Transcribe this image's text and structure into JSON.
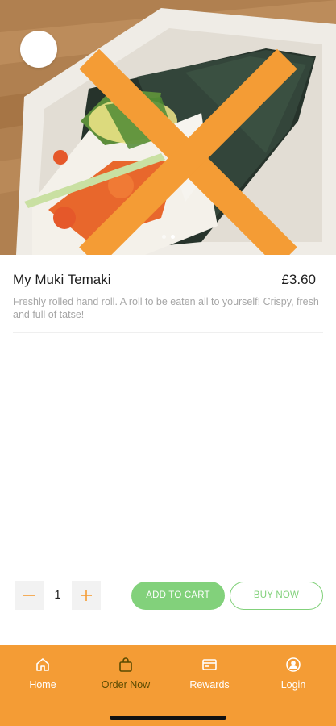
{
  "product": {
    "title": "My Muki Temaki",
    "price": "£3.60",
    "description": "Freshly rolled hand roll. A roll to be eaten all to yourself! Crispy, fresh and full of tatse!",
    "image_icon": "temaki-photo",
    "carousel": {
      "count": 2,
      "active_index": 1
    }
  },
  "quantity": {
    "value": "1",
    "minus_icon": "minus-icon",
    "plus_icon": "plus-icon"
  },
  "actions": {
    "add_to_cart": "ADD TO CART",
    "buy_now": "BUY NOW"
  },
  "nav": {
    "items": [
      {
        "label": "Home",
        "icon": "home-icon"
      },
      {
        "label": "Order Now",
        "icon": "bag-icon"
      },
      {
        "label": "Rewards",
        "icon": "card-icon"
      },
      {
        "label": "Login",
        "icon": "user-icon"
      }
    ],
    "active_index": 1
  },
  "colors": {
    "accent_orange": "#f49c35",
    "accent_green": "#82d17b",
    "active_nav_label": "#5a4a00"
  }
}
